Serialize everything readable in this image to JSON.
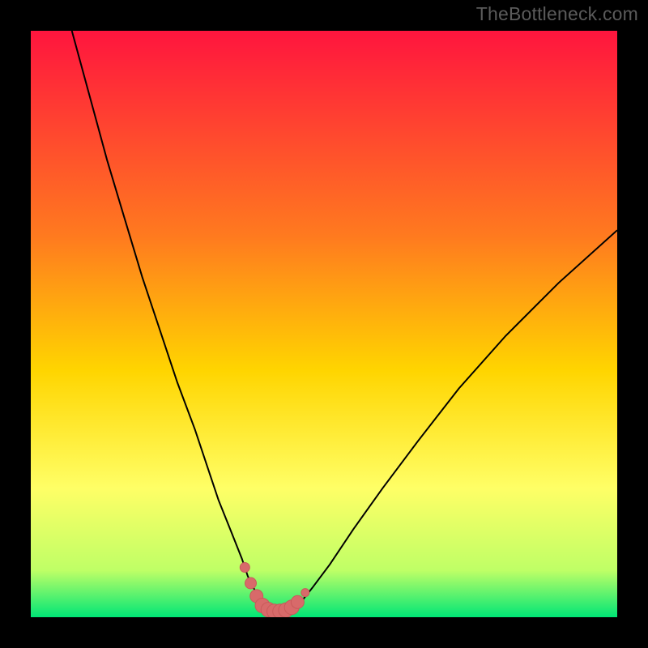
{
  "watermark": "TheBottleneck.com",
  "colors": {
    "background": "#000000",
    "gradient_top": "#ff153e",
    "gradient_mid1": "#ff7a1f",
    "gradient_mid2": "#ffd500",
    "gradient_mid3": "#ffff66",
    "gradient_mid4": "#bfff66",
    "gradient_bottom": "#00e676",
    "curve_stroke": "#000000",
    "marker_fill": "#d86a6a",
    "marker_stroke": "#c95a5a"
  },
  "chart_data": {
    "type": "line",
    "title": "",
    "xlabel": "",
    "ylabel": "",
    "xlim": [
      0,
      100
    ],
    "ylim": [
      0,
      100
    ],
    "series": [
      {
        "name": "bottleneck-curve",
        "x": [
          7,
          10,
          13,
          16,
          19,
          22,
          25,
          28,
          30,
          32,
          34,
          36,
          37,
          38,
          39,
          40,
          41,
          42,
          43,
          44,
          46,
          48,
          51,
          55,
          60,
          66,
          73,
          81,
          90,
          100
        ],
        "values": [
          100,
          89,
          78,
          68,
          58,
          49,
          40,
          32,
          26,
          20,
          15,
          10,
          7,
          5,
          3,
          1.8,
          1.2,
          1,
          1,
          1.4,
          2.5,
          5,
          9,
          15,
          22,
          30,
          39,
          48,
          57,
          66
        ]
      }
    ],
    "markers": {
      "name": "highlighted-range",
      "x": [
        36.5,
        37.5,
        38.5,
        39.5,
        40.5,
        41.5,
        42.5,
        43.5,
        44.5,
        45.5,
        46.8
      ],
      "values": [
        8.5,
        5.8,
        3.6,
        2.0,
        1.3,
        1.0,
        1.0,
        1.2,
        1.7,
        2.6,
        4.2
      ],
      "radius": [
        6,
        7,
        8,
        9,
        9,
        9,
        9,
        9,
        9,
        8,
        5
      ]
    }
  }
}
